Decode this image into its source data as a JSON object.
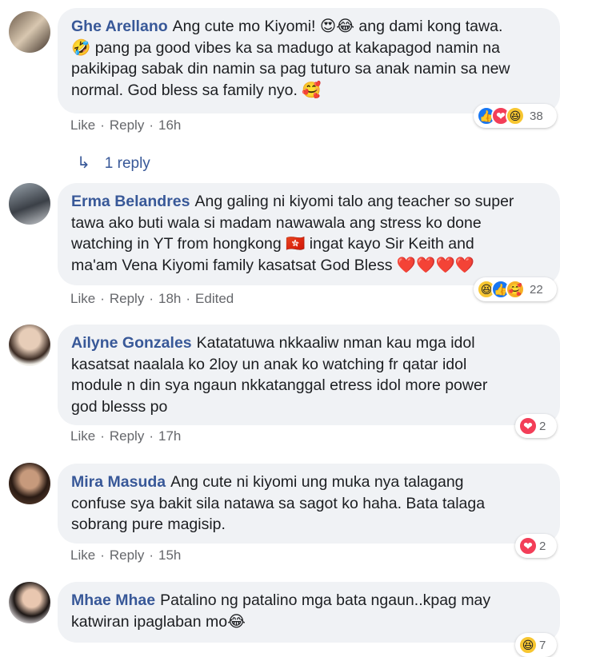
{
  "comments": [
    {
      "author": "Ghe Arellano",
      "lines": [
        "Ang cute mo Kiyomi! 😍😂 ang dami kong tawa.",
        "🤣 pang pa good vibes ka sa madugo at kakapagod namin na",
        "pakikipag sabak din namin sa pag tuturo sa anak namin sa new",
        "normal. God bless sa family nyo. 🥰"
      ],
      "like": "Like",
      "reply": "Reply",
      "time": "16h",
      "extra": "",
      "reaction_icons": [
        "like-reaction-icon",
        "love-reaction-icon",
        "haha-reaction-icon"
      ],
      "reaction_count": "38"
    },
    {
      "author": "Erma Belandres",
      "lines": [
        "Ang galing ni kiyomi talo ang teacher so super",
        "tawa ako buti wala si madam nawawala ang stress ko done",
        "watching in YT from hongkong 🇭🇰 ingat kayo Sir Keith and",
        "ma'am Vena Kiyomi family kasatsat God Bless ❤️❤️❤️❤️"
      ],
      "like": "Like",
      "reply": "Reply",
      "time": "18h",
      "extra": "Edited",
      "reaction_icons": [
        "haha-reaction-icon",
        "like-reaction-icon",
        "care-reaction-icon"
      ],
      "reaction_count": "22"
    },
    {
      "author": "Ailyne Gonzales",
      "lines": [
        "Katatatuwa nkkaaliw nman kau mga idol",
        "kasatsat naalala ko 2loy un anak ko watching fr qatar idol",
        "module n din sya ngaun nkkatanggal etress idol more power",
        "god blesss po"
      ],
      "like": "Like",
      "reply": "Reply",
      "time": "17h",
      "extra": "",
      "reaction_icons": [
        "love-reaction-icon"
      ],
      "reaction_count": "2"
    },
    {
      "author": "Mira Masuda",
      "lines": [
        "Ang cute ni kiyomi ung muka nya talagang",
        "confuse sya bakit sila natawa sa sagot ko haha. Bata talaga",
        "sobrang pure magisip."
      ],
      "like": "Like",
      "reply": "Reply",
      "time": "15h",
      "extra": "",
      "reaction_icons": [
        "love-reaction-icon"
      ],
      "reaction_count": "2"
    },
    {
      "author": "Mhae Mhae",
      "lines": [
        "Patalino ng patalino mga bata ngaun..kpag may",
        "katwiran ipaglaban mo😂"
      ],
      "like": "",
      "reply": "",
      "time": "",
      "extra": "",
      "reaction_icons": [
        "haha-reaction-icon"
      ],
      "reaction_count": "7"
    }
  ],
  "reply_link": {
    "icon": "reply-arrow-icon",
    "label": "1 reply"
  },
  "colors": {
    "author": "#385898",
    "bubble": "#f0f2f5",
    "meta": "#65676b",
    "love": "#f33e58",
    "like": "#1877f2",
    "haha": "#f7c631"
  }
}
